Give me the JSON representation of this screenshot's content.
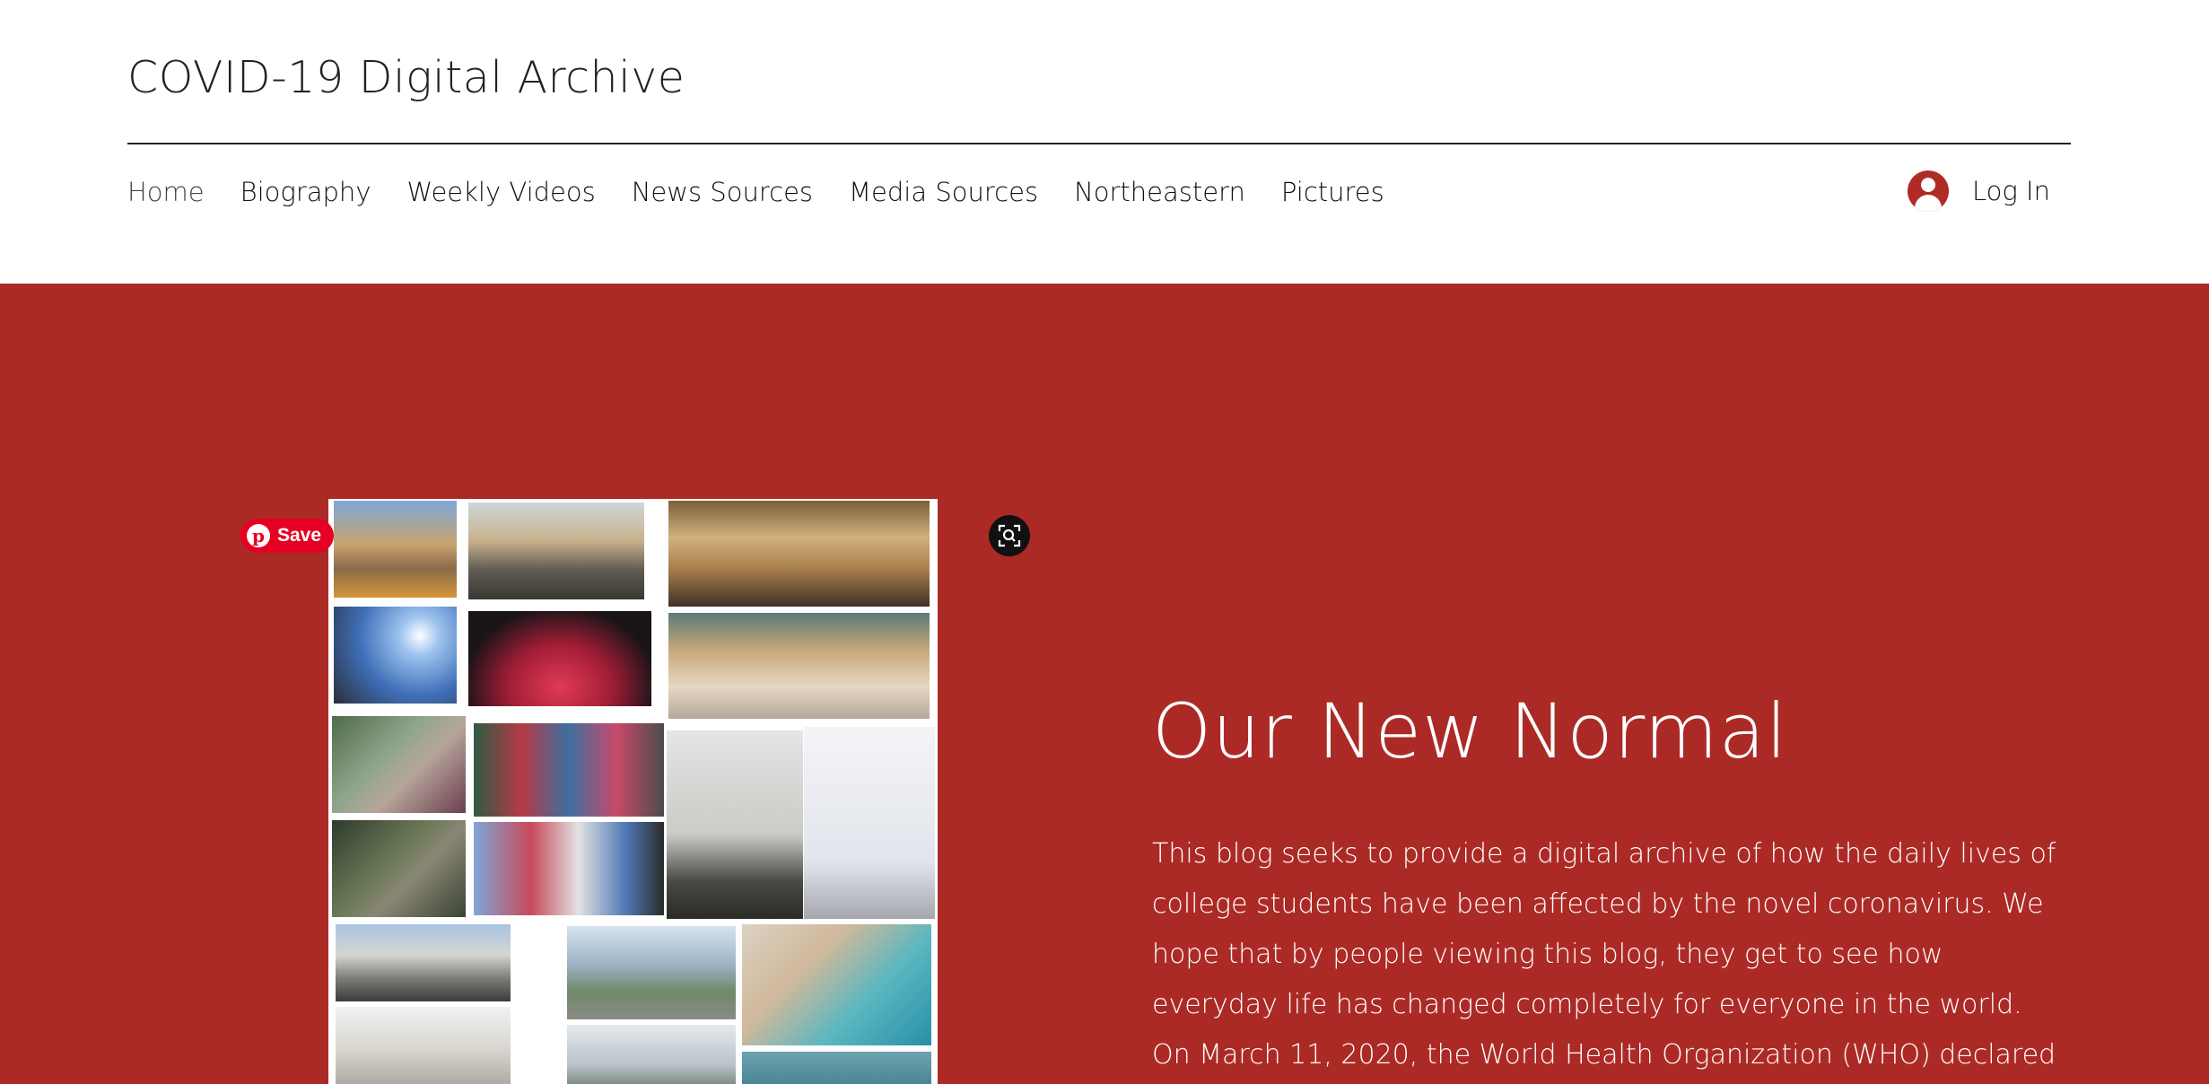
{
  "site": {
    "title": "COVID-19 Digital Archive"
  },
  "nav": {
    "items": [
      {
        "label": "Home",
        "active": true
      },
      {
        "label": "Biography"
      },
      {
        "label": "Weekly Videos"
      },
      {
        "label": "News Sources"
      },
      {
        "label": "Media Sources"
      },
      {
        "label": "Northeastern"
      },
      {
        "label": "Pictures"
      }
    ],
    "login_label": "Log In"
  },
  "hero": {
    "background_color": "#ac2a26",
    "save_label": "Save",
    "title": "Our New Normal",
    "body_lines": [
      "This blog seeks to provide a digital archive of how the daily lives of",
      "college students have been affected by the novel coronavirus. We",
      "hope that by people viewing this blog, they get to see how",
      "everyday life has changed completely for everyone in the world.",
      "On March 11, 2020, the World Health Organization (WHO) declared"
    ]
  },
  "collage": {
    "tiles": [
      {
        "name": "colosseum-crowd-photo"
      },
      {
        "name": "pyramids-crowd-photo"
      },
      {
        "name": "grand-central-photo-1"
      },
      {
        "name": "colosseum-sky-photo"
      },
      {
        "name": "pyramid-light-show-photo"
      },
      {
        "name": "grand-central-photo-2"
      },
      {
        "name": "great-wall-crowd-photo"
      },
      {
        "name": "times-square-photo-1"
      },
      {
        "name": "eiffel-tower-crowd-photo"
      },
      {
        "name": "eiffel-tower-photo"
      },
      {
        "name": "great-wall-empty-photo"
      },
      {
        "name": "times-square-photo-2"
      },
      {
        "name": "louvre-crowd-photo"
      },
      {
        "name": "washington-mall-photo"
      },
      {
        "name": "beach-crowd-photo"
      },
      {
        "name": "louvre-empty-photo"
      },
      {
        "name": "washington-monument-photo"
      },
      {
        "name": "beach-empty-photo"
      }
    ]
  },
  "icons": {
    "user": "user-icon",
    "pinterest": "pinterest-icon",
    "zoom": "zoom-icon"
  }
}
